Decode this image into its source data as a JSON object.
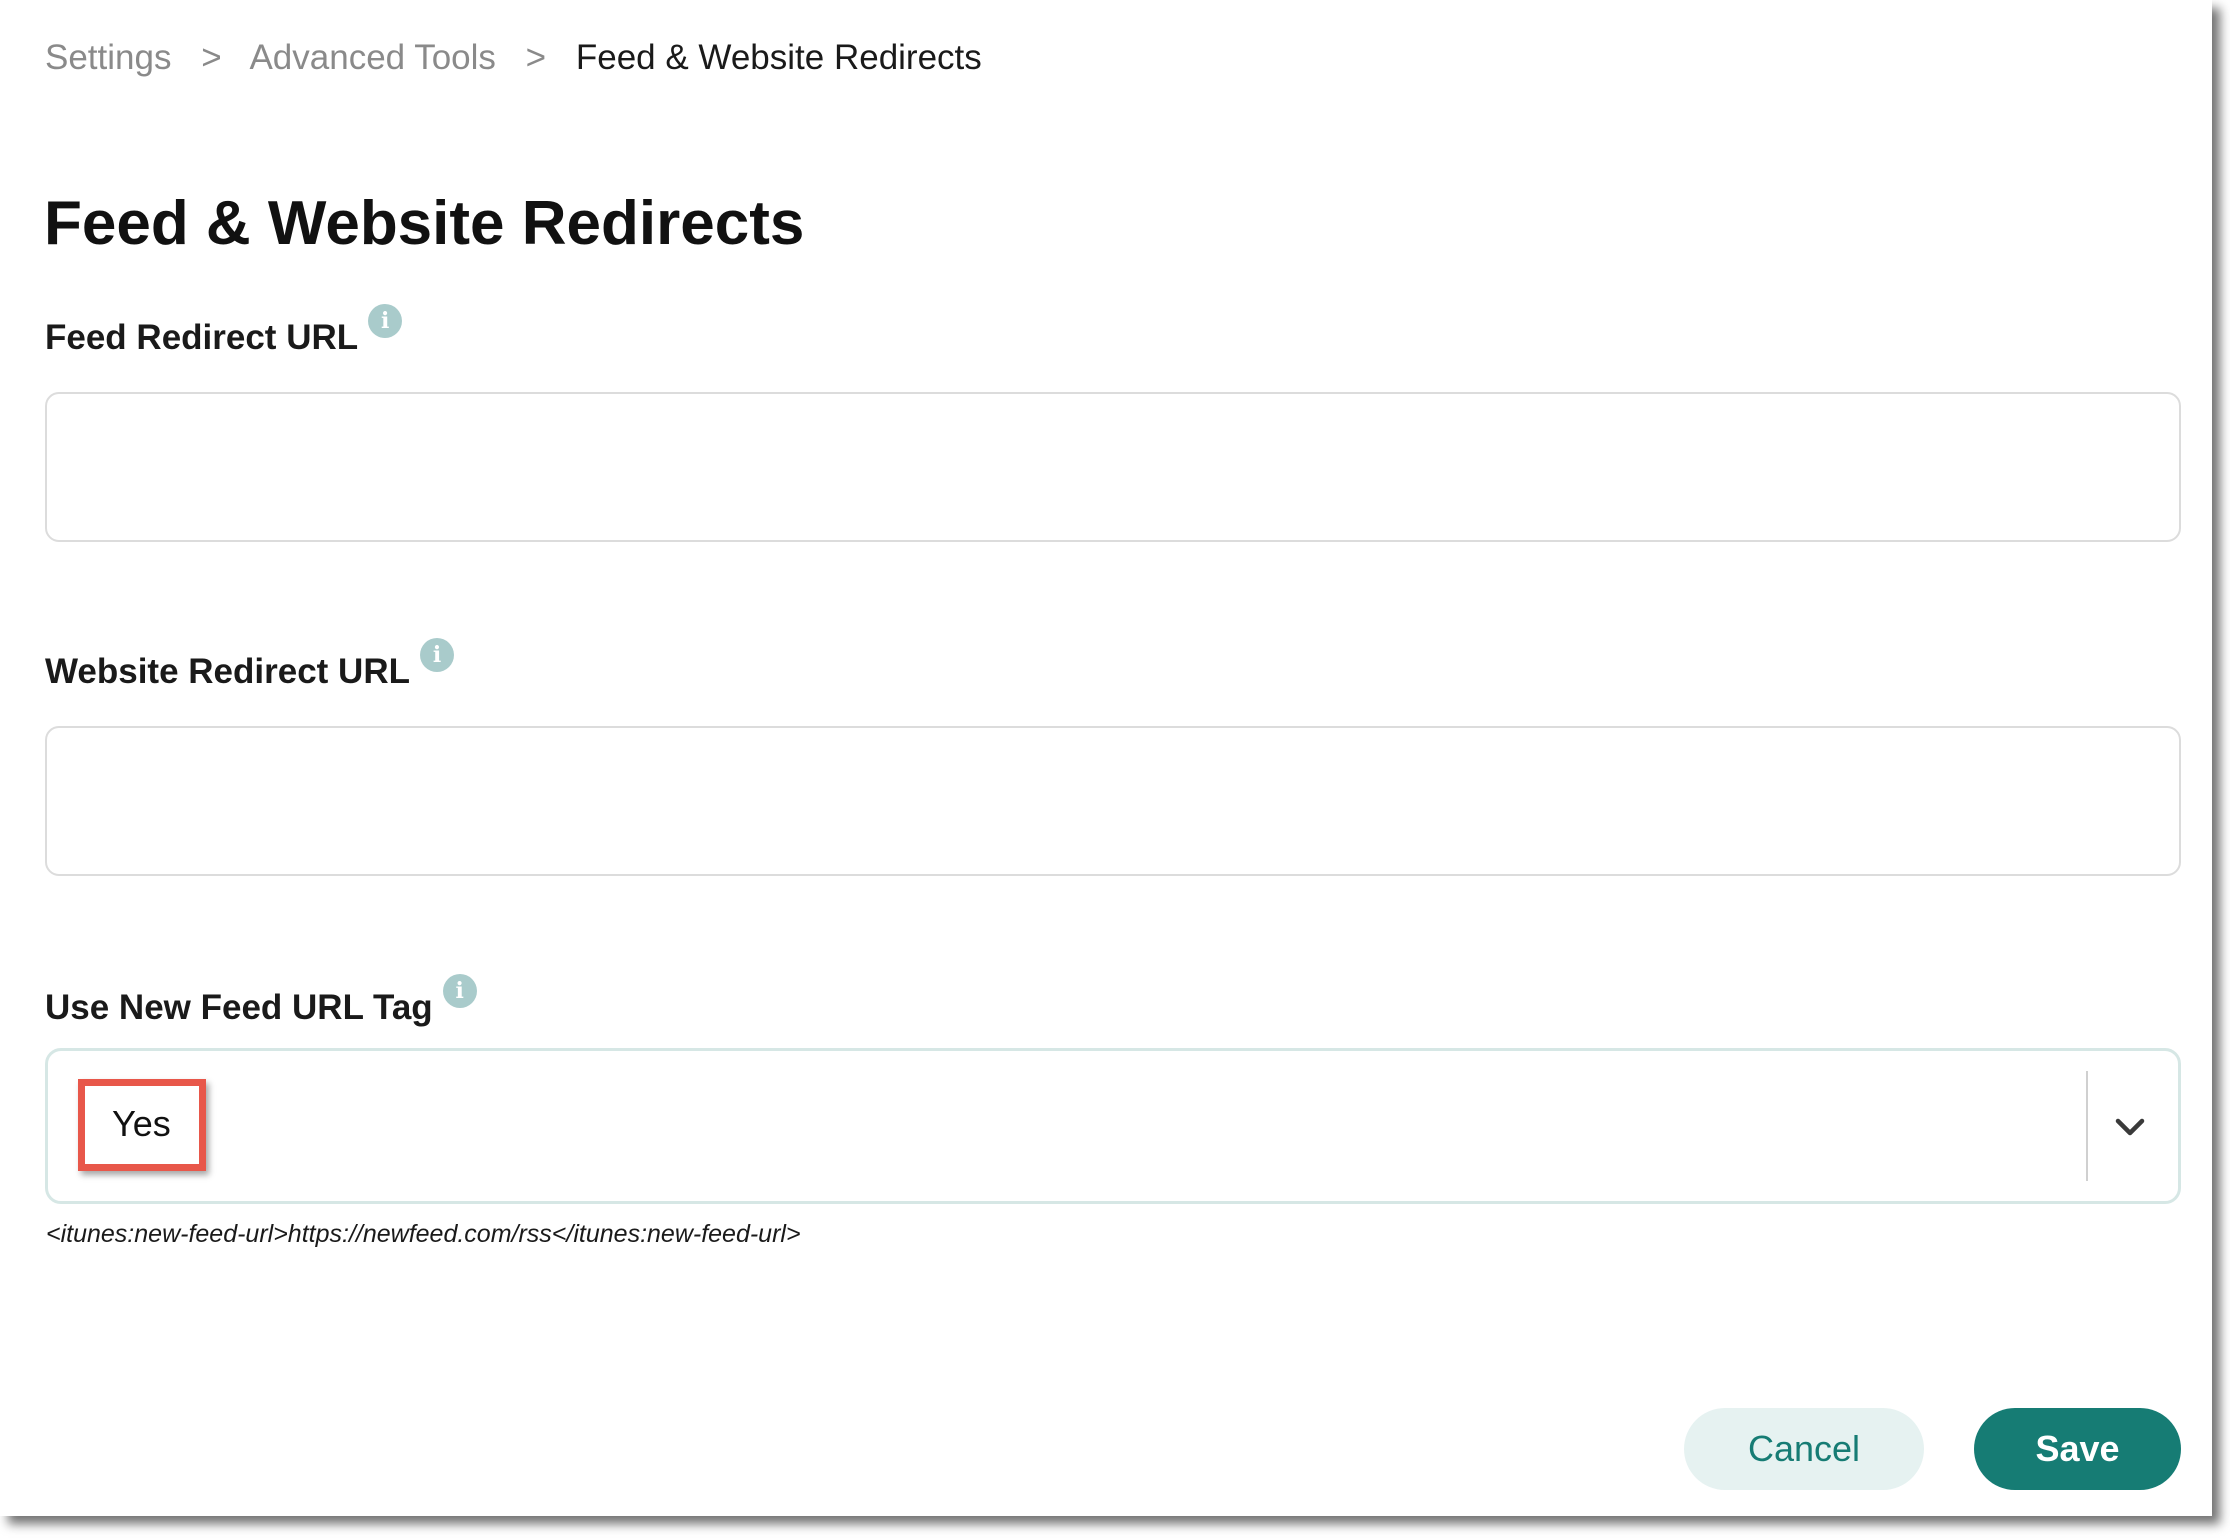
{
  "breadcrumb": {
    "items": [
      "Settings",
      "Advanced Tools",
      "Feed & Website Redirects"
    ],
    "separator": ">"
  },
  "page": {
    "title": "Feed & Website Redirects"
  },
  "fields": {
    "feed_redirect": {
      "label": "Feed Redirect URL",
      "info_icon": "i",
      "value": ""
    },
    "website_redirect": {
      "label": "Website Redirect URL",
      "info_icon": "i",
      "value": ""
    },
    "new_feed_tag": {
      "label": "Use New Feed URL Tag",
      "info_icon": "i",
      "selected": "Yes",
      "helper": "<itunes:new-feed-url>https://newfeed.com/rss</itunes:new-feed-url>"
    }
  },
  "actions": {
    "cancel_label": "Cancel",
    "save_label": "Save"
  },
  "colors": {
    "accent": "#167c74",
    "cancel_bg": "#e6f2f1",
    "info_icon": "#a9cbcb",
    "highlight": "#e8574a"
  },
  "icons": {
    "info": "info-icon",
    "dropdown": "chevron-down-icon"
  }
}
